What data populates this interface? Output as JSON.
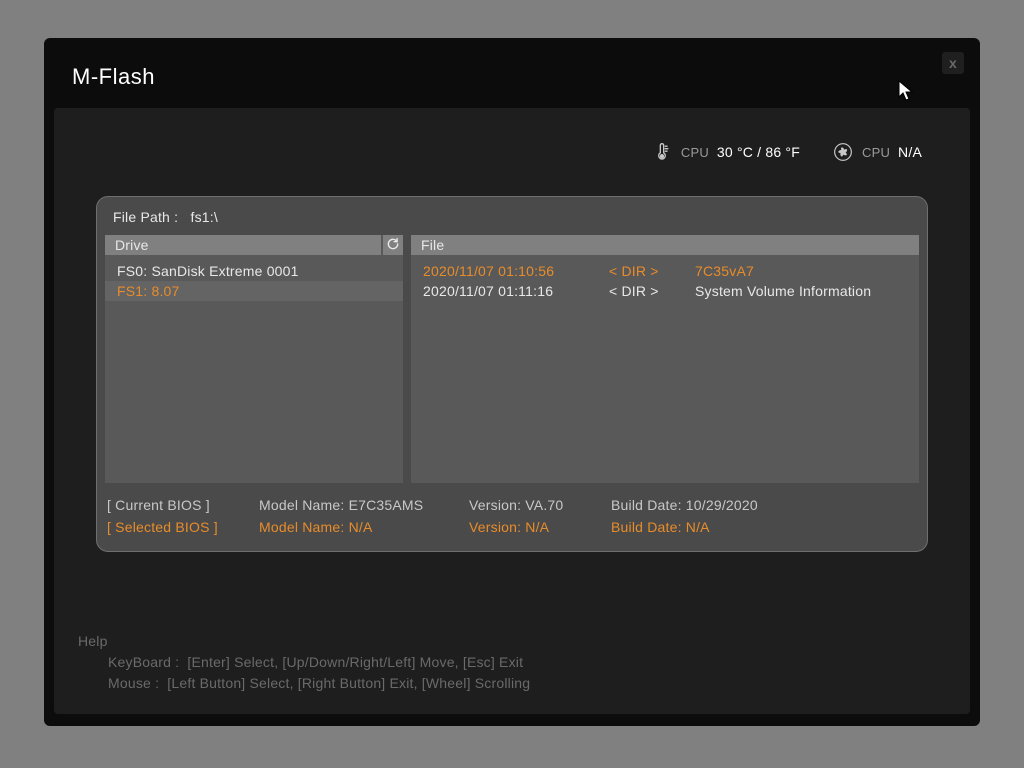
{
  "window": {
    "title": "M-Flash",
    "close_label": "x"
  },
  "status": {
    "temp_label": "CPU",
    "temp_value": "30 °C / 86 °F",
    "fan_label": "CPU",
    "fan_value": "N/A"
  },
  "browser": {
    "path_label": "File Path :",
    "path_value": "fs1:\\",
    "drive_header": "Drive",
    "file_header": "File",
    "drives": [
      {
        "label": "FS0: SanDisk Extreme 0001",
        "selected": false
      },
      {
        "label": "FS1:    8.07",
        "selected": true
      }
    ],
    "files": [
      {
        "date": "2020/11/07 01:10:56",
        "type": "< DIR >",
        "name": "7C35vA7",
        "highlighted": true
      },
      {
        "date": "2020/11/07 01:11:16",
        "type": "< DIR >",
        "name": "System Volume Information",
        "highlighted": false
      }
    ]
  },
  "bios": {
    "current_label": "[ Current BIOS  ]",
    "selected_label": "[ Selected BIOS ]",
    "current": {
      "model_label": "Model Name:",
      "model": "E7C35AMS",
      "version_label": "Version:",
      "version": "VA.70",
      "date_label": "Build Date:",
      "date": "10/29/2020"
    },
    "selected": {
      "model_label": "Model Name:",
      "model": "N/A",
      "version_label": "Version:",
      "version": "N/A",
      "date_label": "Build Date:",
      "date": "N/A"
    }
  },
  "help": {
    "title": "Help",
    "keyboard_label": "KeyBoard :",
    "keyboard_hints": "[Enter]  Select,   [Up/Down/Right/Left]  Move,   [Esc]  Exit",
    "mouse_label": "Mouse     :",
    "mouse_hints": "[Left Button]  Select,   [Right Button]  Exit,   [Wheel]  Scrolling"
  }
}
